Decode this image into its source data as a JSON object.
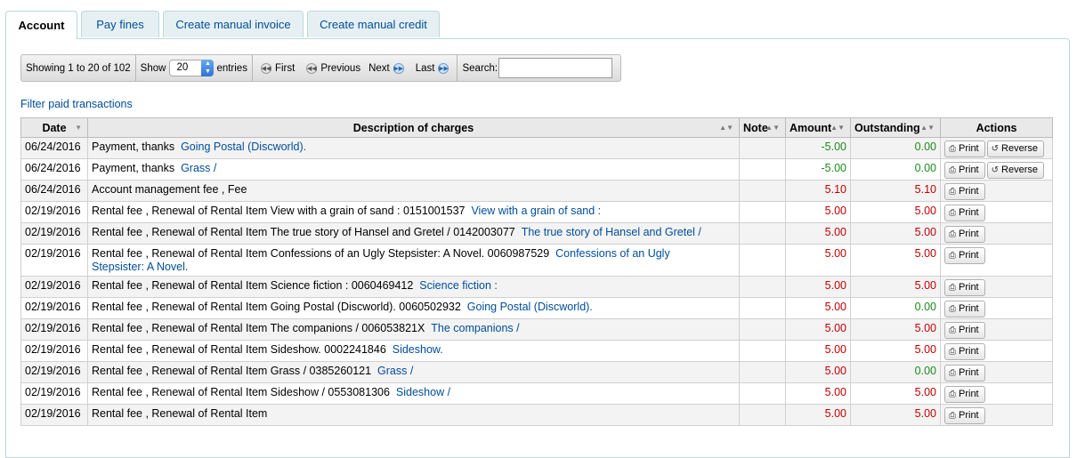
{
  "tabs": [
    {
      "label": "Account",
      "active": true
    },
    {
      "label": "Pay fines",
      "active": false
    },
    {
      "label": "Create manual invoice",
      "active": false
    },
    {
      "label": "Create manual credit",
      "active": false
    }
  ],
  "toolbar": {
    "info": "Showing 1 to 20 of 102",
    "show_label": "Show",
    "page_size": "20",
    "entries_label": "entries",
    "first": "First",
    "previous": "Previous",
    "next": "Next",
    "last": "Last",
    "search_label": "Search:",
    "search_value": ""
  },
  "filter_link": "Filter paid transactions",
  "table": {
    "headers": {
      "date": "Date",
      "description": "Description of charges",
      "note": "Note",
      "amount": "Amount",
      "outstanding": "Outstanding",
      "actions": "Actions"
    },
    "print_label": "Print",
    "reverse_label": "Reverse",
    "rows": [
      {
        "date": "06/24/2016",
        "desc": "Payment, thanks",
        "title": "Going Postal (Discworld).",
        "title2": "",
        "note": "",
        "amount": "-5.00",
        "outstanding": "0.00",
        "reverse": true
      },
      {
        "date": "06/24/2016",
        "desc": "Payment, thanks",
        "title": "Grass /",
        "title2": "",
        "note": "",
        "amount": "-5.00",
        "outstanding": "0.00",
        "reverse": true
      },
      {
        "date": "06/24/2016",
        "desc": "Account management fee , Fee",
        "title": "",
        "title2": "",
        "note": "",
        "amount": "5.10",
        "outstanding": "5.10",
        "reverse": false
      },
      {
        "date": "02/19/2016",
        "desc": "Rental fee , Renewal of Rental Item View with a grain of sand : 0151001537",
        "title": "View with a grain of sand :",
        "title2": "",
        "note": "",
        "amount": "5.00",
        "outstanding": "5.00",
        "reverse": false
      },
      {
        "date": "02/19/2016",
        "desc": "Rental fee , Renewal of Rental Item The true story of Hansel and Gretel / 0142003077",
        "title": "The true story of Hansel and Gretel /",
        "title2": "",
        "note": "",
        "amount": "5.00",
        "outstanding": "5.00",
        "reverse": false
      },
      {
        "date": "02/19/2016",
        "desc": "Rental fee , Renewal of Rental Item Confessions of an Ugly Stepsister: A Novel. 0060987529",
        "title": "Confessions of an Ugly",
        "title2": "Stepsister: A Novel.",
        "note": "",
        "amount": "5.00",
        "outstanding": "5.00",
        "reverse": false
      },
      {
        "date": "02/19/2016",
        "desc": "Rental fee , Renewal of Rental Item Science fiction : 0060469412",
        "title": "Science fiction :",
        "title2": "",
        "note": "",
        "amount": "5.00",
        "outstanding": "5.00",
        "reverse": false
      },
      {
        "date": "02/19/2016",
        "desc": "Rental fee , Renewal of Rental Item Going Postal (Discworld). 0060502932",
        "title": "Going Postal (Discworld).",
        "title2": "",
        "note": "",
        "amount": "5.00",
        "outstanding": "0.00",
        "reverse": false
      },
      {
        "date": "02/19/2016",
        "desc": "Rental fee , Renewal of Rental Item The companions / 006053821X",
        "title": "The companions /",
        "title2": "",
        "note": "",
        "amount": "5.00",
        "outstanding": "5.00",
        "reverse": false
      },
      {
        "date": "02/19/2016",
        "desc": "Rental fee , Renewal of Rental Item Sideshow. 0002241846",
        "title": "Sideshow.",
        "title2": "",
        "note": "",
        "amount": "5.00",
        "outstanding": "5.00",
        "reverse": false
      },
      {
        "date": "02/19/2016",
        "desc": "Rental fee , Renewal of Rental Item Grass / 0385260121",
        "title": "Grass /",
        "title2": "",
        "note": "",
        "amount": "5.00",
        "outstanding": "0.00",
        "reverse": false
      },
      {
        "date": "02/19/2016",
        "desc": "Rental fee , Renewal of Rental Item Sideshow / 0553081306",
        "title": "Sideshow /",
        "title2": "",
        "note": "",
        "amount": "5.00",
        "outstanding": "5.00",
        "reverse": false
      },
      {
        "date": "02/19/2016",
        "desc": "Rental fee , Renewal of Rental Item",
        "title": "",
        "title2": "",
        "note": "",
        "amount": "5.00",
        "outstanding": "5.00",
        "reverse": false
      }
    ]
  },
  "colors": {
    "link": "#004d99",
    "negative_amount": "#1a8a1a",
    "positive_amount": "#c00000",
    "zero_outstanding": "#1a8a1a"
  }
}
